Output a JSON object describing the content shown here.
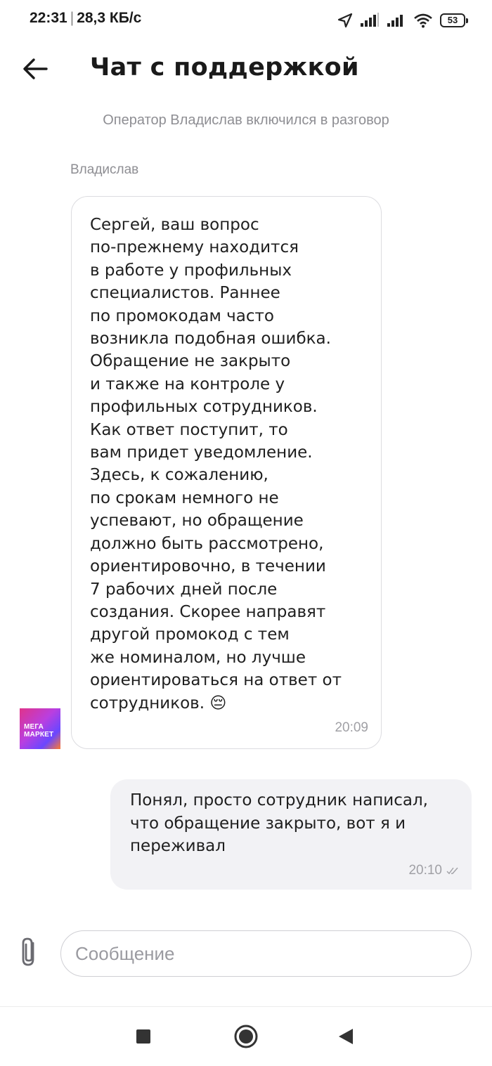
{
  "status_bar": {
    "time": "22:31",
    "speed": "28,3 КБ/с",
    "battery": "53"
  },
  "header": {
    "title": "Чат с поддержкой"
  },
  "chat": {
    "system_message": "Оператор Владислав включился в разговор",
    "incoming": {
      "sender": "Владислав",
      "text": "Сергей, ваш вопрос\nпо-прежнему находится\nв работе у профильных\nспециалистов. Раннее\nпо промокодам часто\nвозникла подобная ошибка.\nОбращение не закрыто\nи также на контроле у\nпрофильных сотрудников.\nКак ответ поступит, то\nвам придет уведомление.\nЗдесь, к сожалению,\nпо срокам немного не\nуспевают, но обращение\nдолжно быть рассмотрено,\nориентировочно, в течении\n7 рабочих дней после\nсоздания. Скорее направят\nдругой промокод с тем\nже номиналом, но лучше\nориентироваться на ответ от\nсотрудников. 😔",
      "time": "20:09",
      "avatar_text": "МЕГА\nМАРКЕТ"
    },
    "outgoing": {
      "text": "Понял, просто сотрудник написал,\nчто обращение закрыто, вот я и\nпереживал",
      "time": "20:10",
      "status_icon": "double-check-icon"
    }
  },
  "composer": {
    "placeholder": "Сообщение",
    "value": ""
  },
  "colors": {
    "avatar_gradient": [
      "#e0338a",
      "#b93fe0",
      "#6a47ff",
      "#ff7a2e"
    ],
    "outgoing_bubble": "#f2f2f5",
    "meta_text": "#8e8e93"
  }
}
